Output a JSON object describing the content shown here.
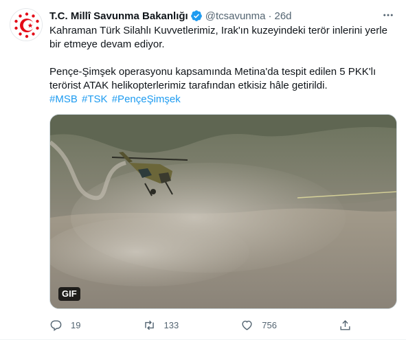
{
  "author": {
    "name": "T.C. Millî Savunma Bakanlığı",
    "handle": "@tcsavunma",
    "separator": "·",
    "time": "26d"
  },
  "tweet": {
    "paragraph1": "Kahraman Türk Silahlı Kuvvetlerimiz, Irak'ın kuzeyindeki terör inlerini yerle bir etmeye devam ediyor.",
    "paragraph2": "Pençe-Şimşek operasyonu kapsamında Metina'da tespit edilen 5 PKK'lı terörist ATAK helikopterlerimiz tarafından etkisiz hâle getirildi.",
    "hashtags": [
      "#MSB",
      "#TSK",
      "#PençeŞimşek"
    ]
  },
  "media": {
    "badge": "GIF"
  },
  "actions": {
    "reply_count": "19",
    "retweet_count": "133",
    "like_count": "756"
  },
  "colors": {
    "accent": "#1d9bf0",
    "secondary_text": "#536471",
    "emblem_red": "#e30a17"
  }
}
